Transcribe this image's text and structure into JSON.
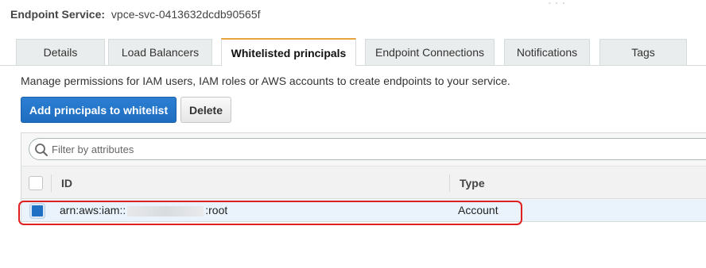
{
  "header": {
    "label": "Endpoint Service:",
    "value": "vpce-svc-0413632dcdb90565f",
    "dots": "° ° °"
  },
  "tabs": [
    {
      "label": "Details"
    },
    {
      "label": "Load Balancers"
    },
    {
      "label": "Whitelisted principals",
      "active": true
    },
    {
      "label": "Endpoint Connections"
    },
    {
      "label": "Notifications"
    },
    {
      "label": "Tags"
    }
  ],
  "description": "Manage permissions for IAM users, IAM roles or AWS accounts to create endpoints to your service.",
  "buttons": {
    "add": "Add principals to whitelist",
    "delete": "Delete"
  },
  "filter": {
    "placeholder": "Filter by attributes"
  },
  "table": {
    "columns": [
      "ID",
      "Type"
    ],
    "rows": [
      {
        "id_prefix": "arn:aws:iam::",
        "id_suffix": ":root",
        "type": "Account",
        "selected": true
      }
    ]
  },
  "colors": {
    "primary": "#1f6dc0",
    "active_tab_accent": "#e7a33e",
    "highlight": "#e02020"
  }
}
